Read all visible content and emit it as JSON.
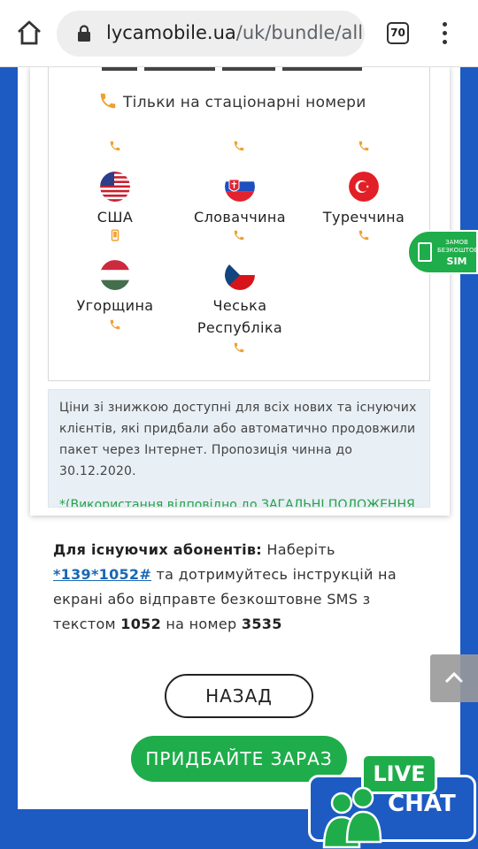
{
  "browser": {
    "url_host": "lycamobile.ua",
    "url_path": "/uk/bundle/all-i",
    "tab_count": "70"
  },
  "rates": {
    "landline_label": "Тільки на стаціонарні номери",
    "countries": [
      {
        "name": "США"
      },
      {
        "name": "Словаччина"
      },
      {
        "name": "Туреччина"
      },
      {
        "name": "Угорщина"
      },
      {
        "name": "Чеська Республіка",
        "line1": "Чеська",
        "line2": "Республіка"
      }
    ]
  },
  "notice": {
    "text": "Ціни зі знижкою доступні для всіх нових та існуючих клієнтів, які придбали або автоматично продовжили пакет через Інтернет. Пропозиція чинна до 30.12.2020.",
    "cut_text": "*(Використання відповідно до ЗАГАЛЬНІ ПОЛОЖЕННЯ"
  },
  "existing": {
    "label": "Для існуючих абонентів:",
    "dial_prefix": "Наберіть",
    "code": "*139*1052#",
    "rest": "та дотримуйтесь інструкцій на екрані або відправте безкоштовне SMS з текстом",
    "sms_text": "1052",
    "to": "на номер",
    "number": "3535"
  },
  "buttons": {
    "back": "НАЗАД",
    "buy": "ПРИДБАЙТЕ ЗАРАЗ"
  },
  "sim_badge": {
    "line1": "ЗАМОВ",
    "line2": "БЕЗКОШТОВНУ",
    "line3": "SIM"
  },
  "livechat": {
    "live": "LIVE",
    "chat": "CHAT"
  },
  "colors": {
    "brand_blue": "#1d5bc3",
    "accent_green": "#1ead4a",
    "phone_orange": "#f0a030",
    "link_blue": "#1a67b4"
  }
}
